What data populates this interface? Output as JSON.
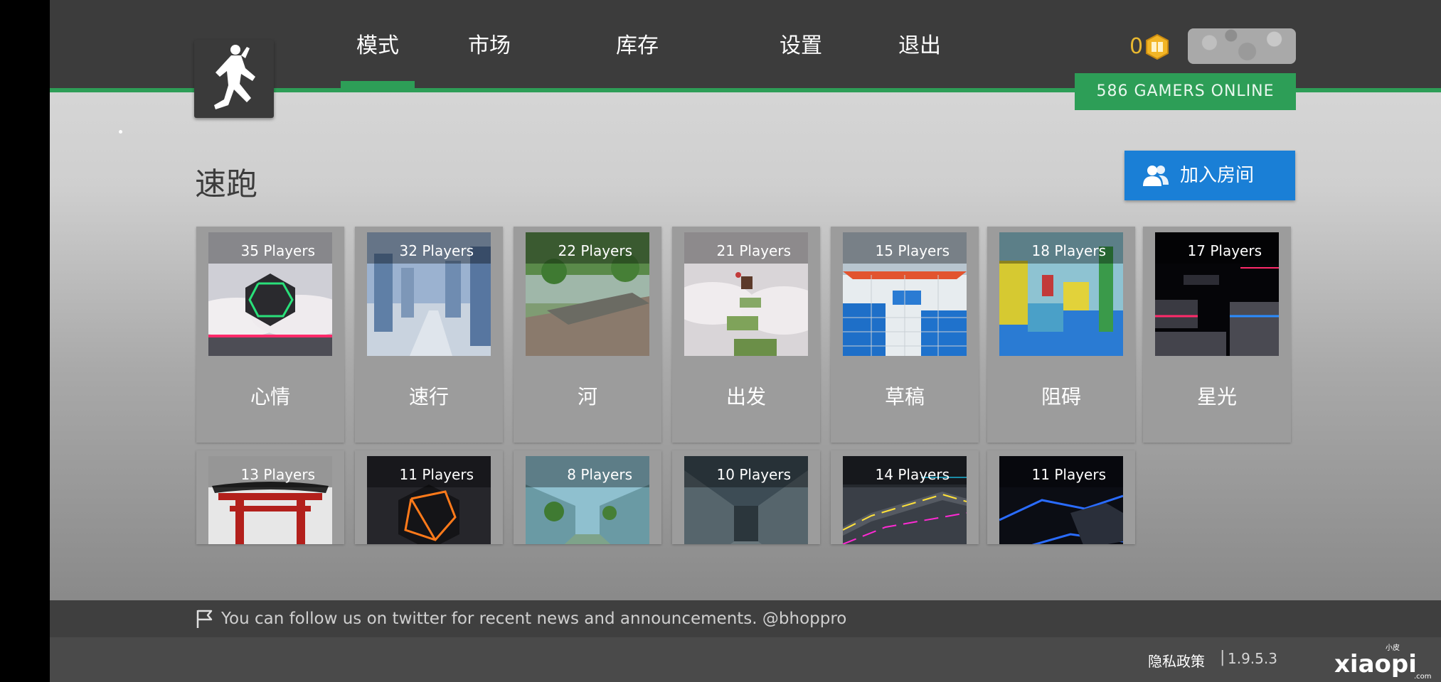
{
  "nav": {
    "items": [
      "模式",
      "市场",
      "库存",
      "设置",
      "退出"
    ],
    "active_index": 0
  },
  "header": {
    "coins": "0",
    "online": "586 GAMERS ONLINE"
  },
  "section": {
    "title": "速跑",
    "join_label": "加入房间"
  },
  "maps": [
    {
      "players": "35 Players",
      "name": "心情",
      "theme": "cube-cloud"
    },
    {
      "players": "32 Players",
      "name": "速行",
      "theme": "blue-city"
    },
    {
      "players": "22 Players",
      "name": "河",
      "theme": "river"
    },
    {
      "players": "21 Players",
      "name": "出发",
      "theme": "cloud-path"
    },
    {
      "players": "15 Players",
      "name": "草稿",
      "theme": "blue-tiles"
    },
    {
      "players": "18 Players",
      "name": "阻碍",
      "theme": "colorful"
    },
    {
      "players": "17 Players",
      "name": "星光",
      "theme": "neon-dark"
    },
    {
      "players": "13 Players",
      "name": "",
      "theme": "torii"
    },
    {
      "players": "11 Players",
      "name": "",
      "theme": "orange-cube"
    },
    {
      "players": "8 Players",
      "name": "",
      "theme": "green-hall"
    },
    {
      "players": "10 Players",
      "name": "",
      "theme": "tunnel"
    },
    {
      "players": "14 Players",
      "name": "",
      "theme": "neon-path"
    },
    {
      "players": "11 Players",
      "name": "",
      "theme": "blue-neon"
    }
  ],
  "news": "You can follow us on twitter for recent news and announcements. @bhoppro",
  "footer": {
    "privacy": "隐私政策",
    "separator": "|",
    "version": "1.9.5.3"
  },
  "watermark": {
    "top": "小皮",
    "main": "xiaopi",
    "sub": ".com"
  },
  "colors": {
    "accent_green": "#2d9e57",
    "join_blue": "#1a7fd6",
    "coin_gold": "#e8b830"
  }
}
